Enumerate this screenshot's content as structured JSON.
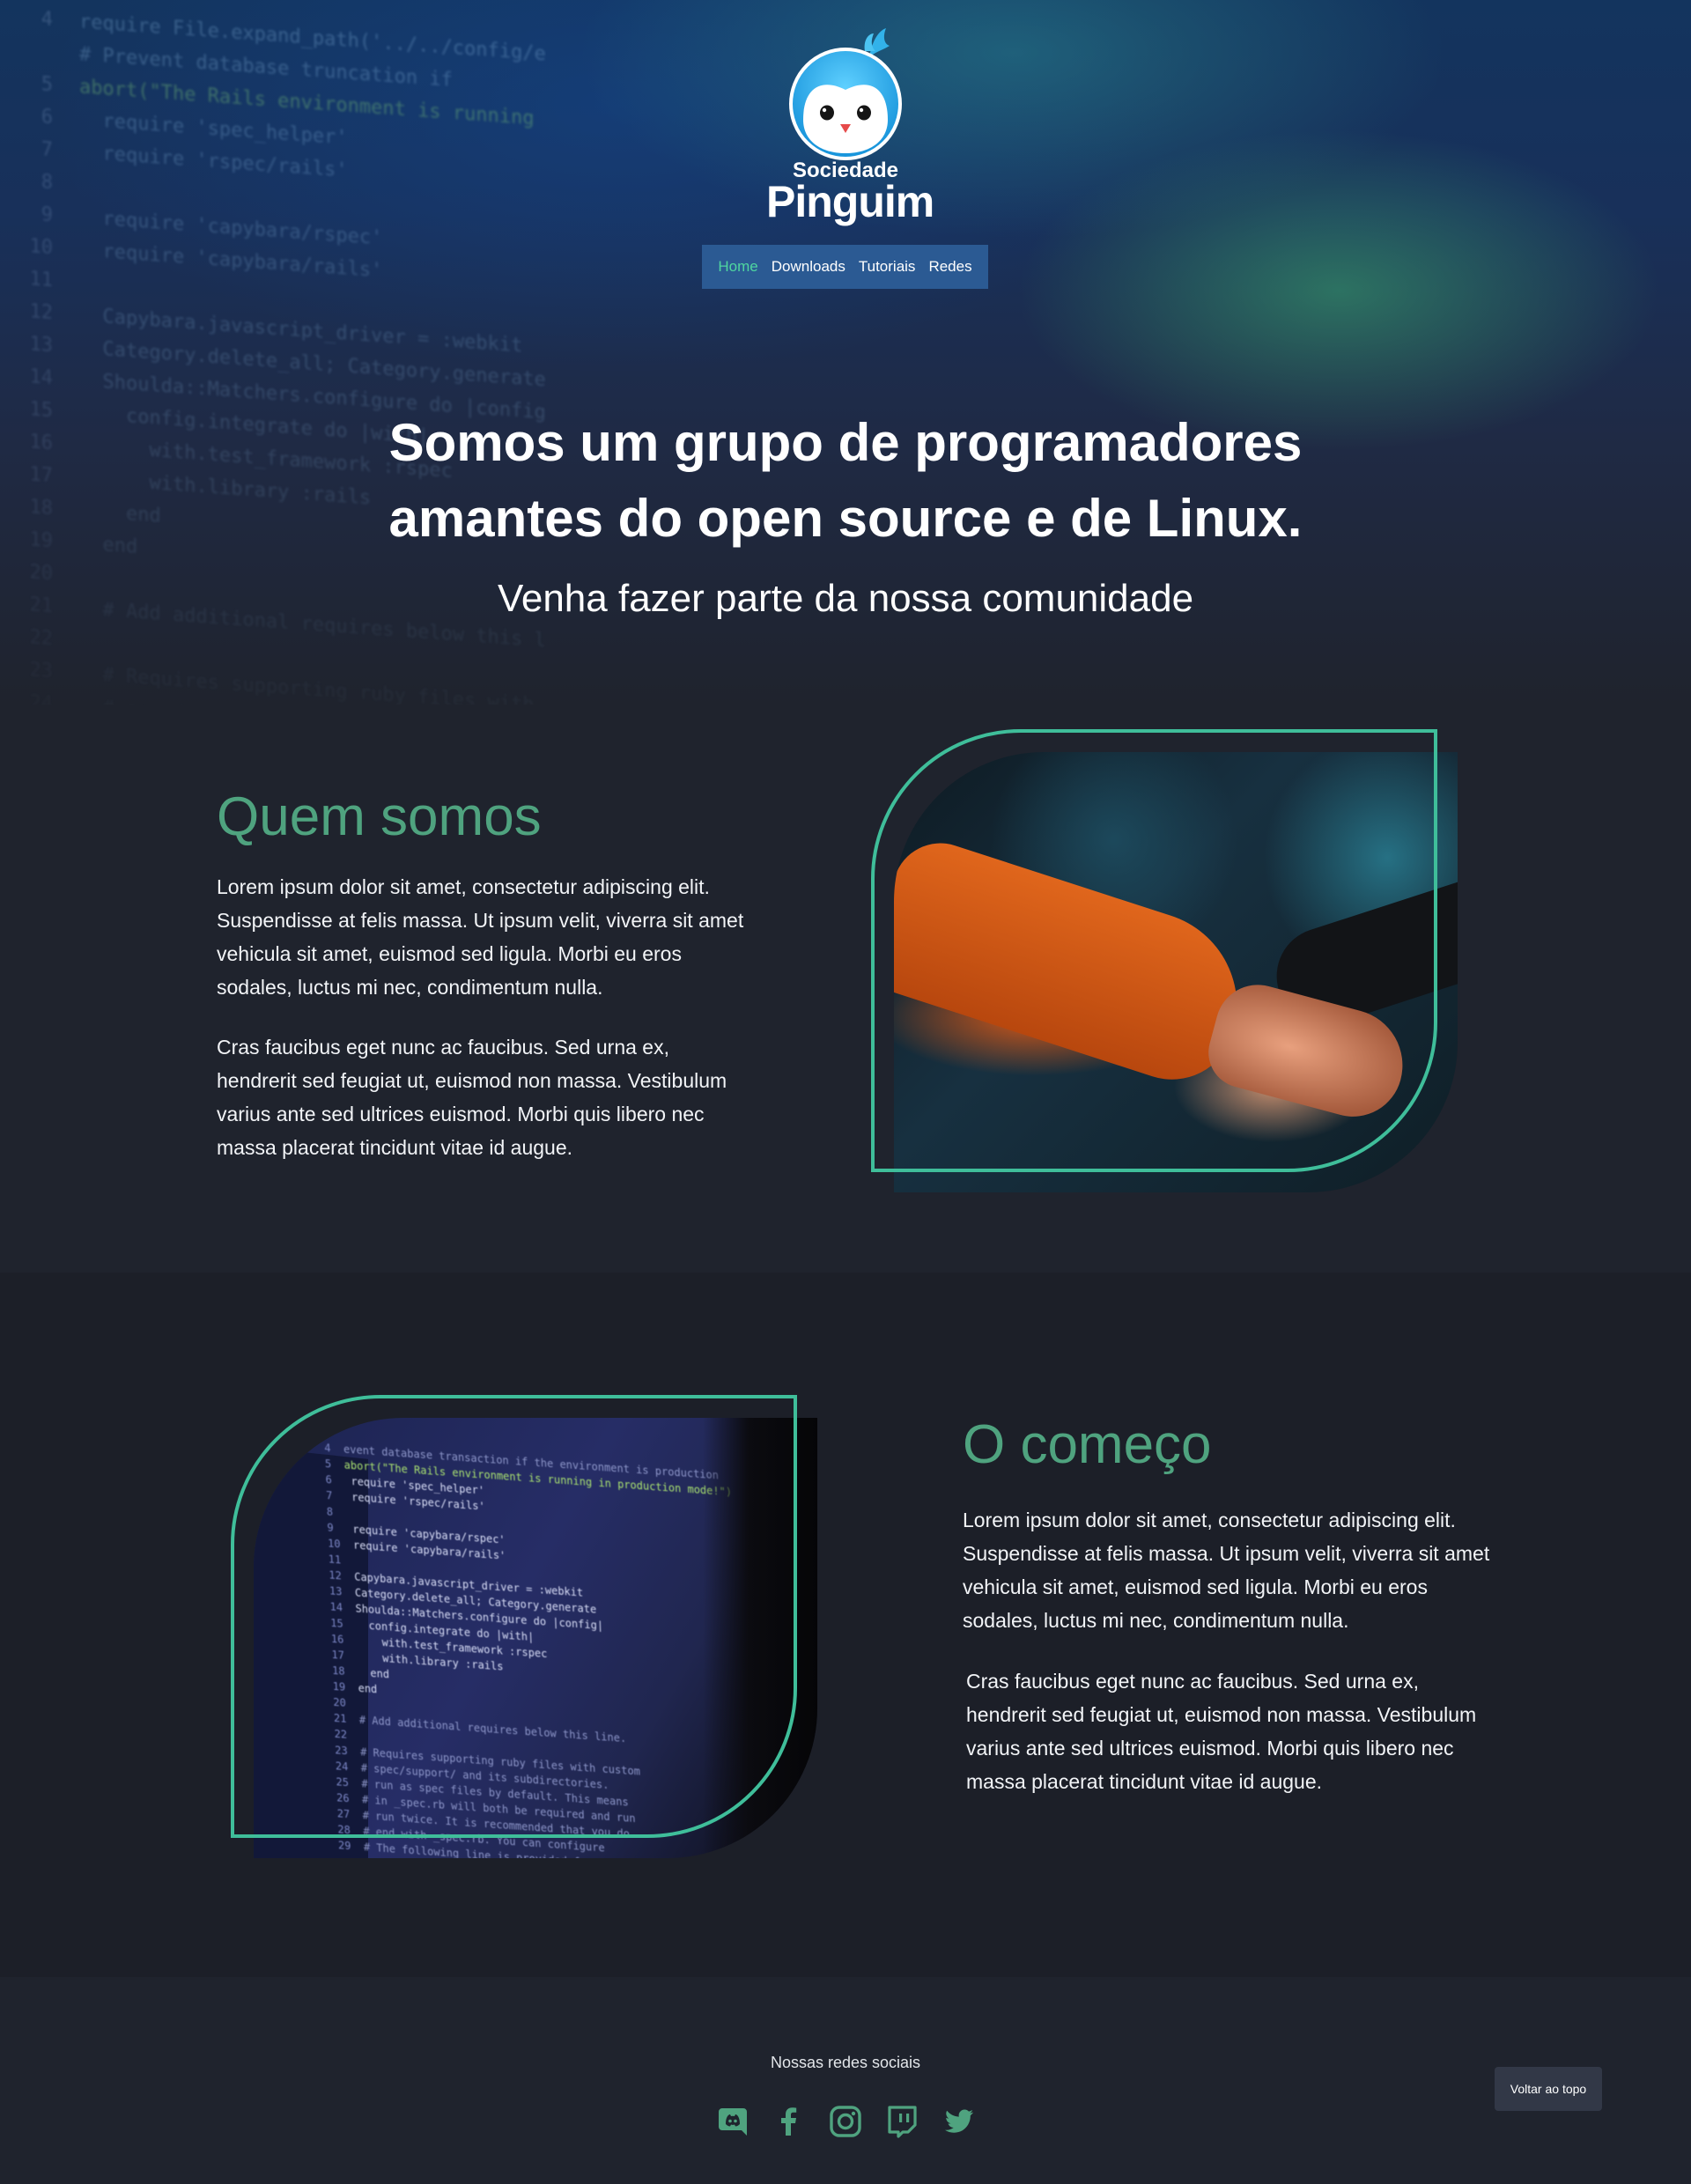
{
  "logo": {
    "small": "Sociedade",
    "big": "Pinguim"
  },
  "nav": {
    "items": [
      {
        "label": "Home",
        "active": true
      },
      {
        "label": "Downloads",
        "active": false
      },
      {
        "label": "Tutoriais",
        "active": false
      },
      {
        "label": "Redes",
        "active": false
      }
    ]
  },
  "hero": {
    "title_line1": "Somos um grupo de programadores",
    "title_line2": "amantes do open source e de Linux.",
    "subtitle": "Venha fazer parte da nossa comunidade"
  },
  "about": {
    "title": "Quem somos",
    "paragraph1": "Lorem ipsum dolor sit amet, consectetur adipiscing elit. Suspendisse at felis massa. Ut ipsum velit, viverra sit amet vehicula sit amet, euismod sed ligula. Morbi eu eros sodales, luctus mi nec, condimentum nulla.",
    "paragraph2": "Cras faucibus eget nunc ac faucibus. Sed urna ex, hendrerit sed feugiat ut, euismod non massa. Vestibulum varius ante sed ultrices euismod. Morbi quis libero nec massa placerat tincidunt vitae id augue."
  },
  "beginning": {
    "title": "O começo",
    "paragraph1": "Lorem ipsum dolor sit amet, consectetur adipiscing elit. Suspendisse at felis massa. Ut ipsum velit, viverra sit amet vehicula sit amet, euismod sed ligula. Morbi eu eros sodales, luctus mi nec, condimentum nulla.",
    "paragraph2": "Cras faucibus eget nunc ac faucibus. Sed urna ex, hendrerit sed feugiat ut, euismod non massa. Vestibulum varius ante sed ultrices euismod. Morbi quis libero nec massa placerat tincidunt vitae id augue."
  },
  "footer": {
    "title": "Nossas redes sociais",
    "socials": [
      "discord-icon",
      "facebook-icon",
      "instagram-icon",
      "twitch-icon",
      "twitter-icon"
    ],
    "back_to_top": "Voltar ao topo"
  },
  "colors": {
    "accent": "#4fa37f",
    "outline": "#3fbe9a",
    "nav_bg": "#2b5a93",
    "nav_active": "#4fd6a0",
    "page_bg": "#1f232d"
  }
}
